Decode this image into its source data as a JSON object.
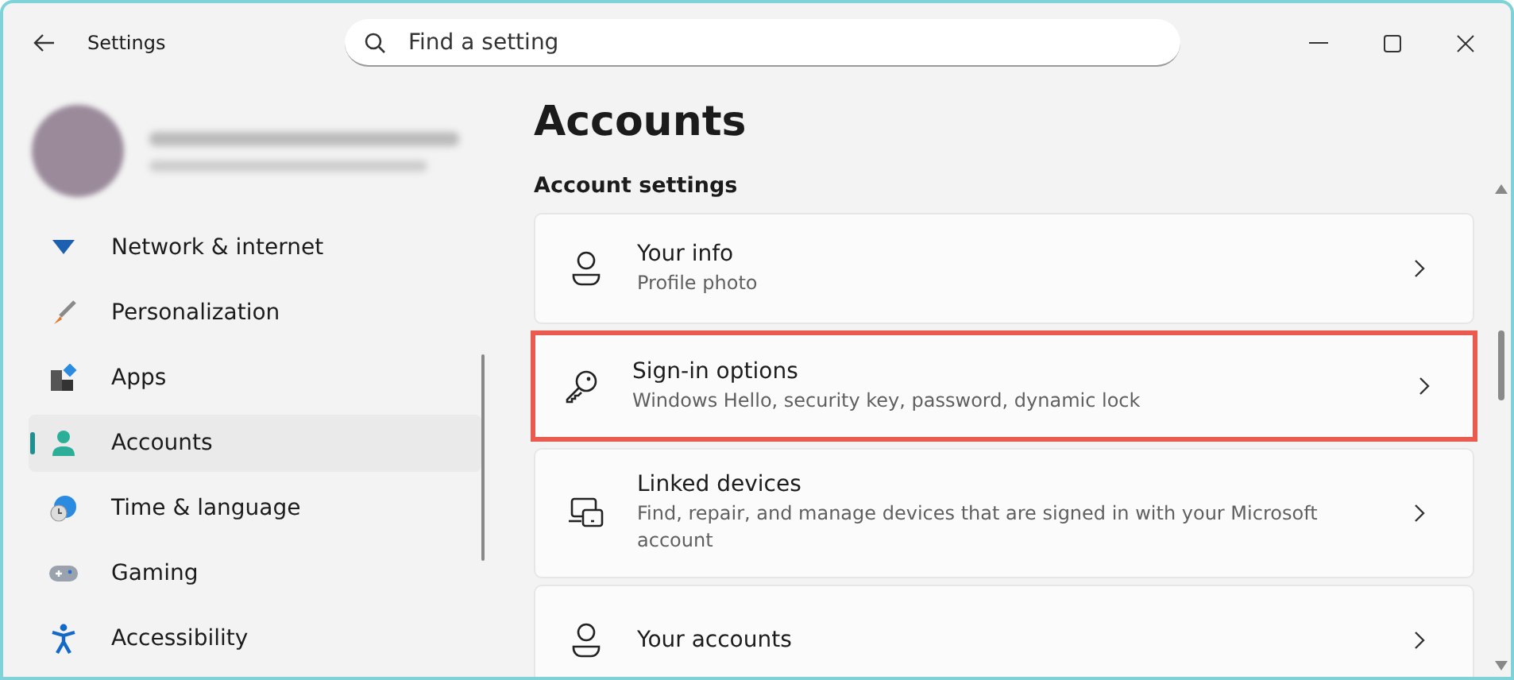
{
  "window": {
    "title": "Settings"
  },
  "search": {
    "placeholder": "Find a setting"
  },
  "sidebar": {
    "items": [
      {
        "label": "Network & internet",
        "selected": false
      },
      {
        "label": "Personalization",
        "selected": false
      },
      {
        "label": "Apps",
        "selected": false
      },
      {
        "label": "Accounts",
        "selected": true
      },
      {
        "label": "Time & language",
        "selected": false
      },
      {
        "label": "Gaming",
        "selected": false
      },
      {
        "label": "Accessibility",
        "selected": false
      }
    ]
  },
  "page": {
    "title": "Accounts",
    "section": "Account settings",
    "cards": [
      {
        "title": "Your info",
        "subtitle": "Profile photo",
        "highlighted": false
      },
      {
        "title": "Sign-in options",
        "subtitle": "Windows Hello, security key, password, dynamic lock",
        "highlighted": true
      },
      {
        "title": "Linked devices",
        "subtitle": "Find, repair, and manage devices that are signed in with your Microsoft account",
        "highlighted": false
      },
      {
        "title": "Your accounts",
        "highlighted": false
      }
    ]
  }
}
